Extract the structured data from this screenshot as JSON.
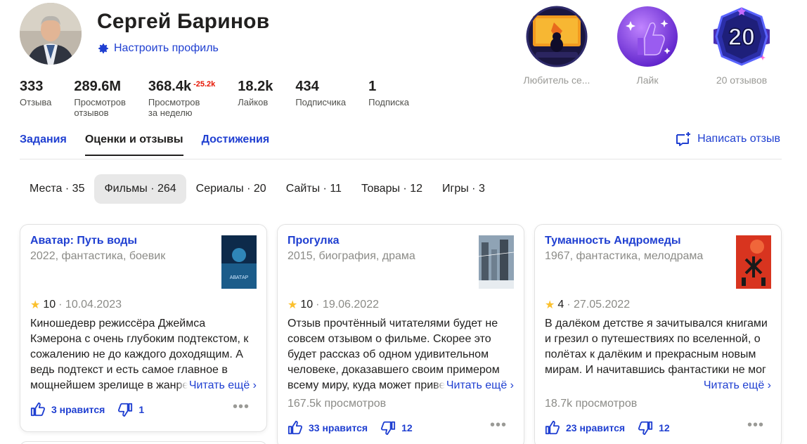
{
  "profile": {
    "name": "Сергей Баринов",
    "configure_label": "Настроить профиль"
  },
  "stats": [
    {
      "value": "333",
      "delta": "",
      "label1": "Отзыва",
      "label2": ""
    },
    {
      "value": "289.6M",
      "delta": "",
      "label1": "Просмотров",
      "label2": "отзывов"
    },
    {
      "value": "368.4k",
      "delta": "-25.2k",
      "label1": "Просмотров",
      "label2": "за неделю"
    },
    {
      "value": "18.2k",
      "delta": "",
      "label1": "Лайков",
      "label2": ""
    },
    {
      "value": "434",
      "delta": "",
      "label1": "Подписчика",
      "label2": ""
    },
    {
      "value": "1",
      "delta": "",
      "label1": "Подписка",
      "label2": ""
    }
  ],
  "badges": [
    {
      "icon": "movie-lover-badge-icon",
      "caption": "Любитель се..."
    },
    {
      "icon": "like-badge-icon",
      "caption": "Лайк"
    },
    {
      "icon": "reviews-20-badge-icon",
      "caption": "20 отзывов",
      "number": "20"
    }
  ],
  "tabs": [
    {
      "label": "Задания",
      "active": false
    },
    {
      "label": "Оценки и отзывы",
      "active": true
    },
    {
      "label": "Достижения",
      "active": false
    }
  ],
  "write_review_label": "Написать отзыв",
  "filters": [
    {
      "label": "Места · 35",
      "active": false
    },
    {
      "label": "Фильмы · 264",
      "active": true
    },
    {
      "label": "Сериалы · 20",
      "active": false
    },
    {
      "label": "Сайты · 11",
      "active": false
    },
    {
      "label": "Товары · 12",
      "active": false
    },
    {
      "label": "Игры · 3",
      "active": false
    }
  ],
  "read_more_label": "Читать ещё ›",
  "cards": [
    {
      "title": "Аватар: Путь воды",
      "meta": "2022, фантастика, боевик",
      "rating": "10",
      "date": "· 10.04.2023",
      "text": "Киношедевр режиссёра Джеймса Кэмерона с очень глубоким подтекстом, к сожалению не до каждого доходящим. А ведь подтекст и есть самое главное в мощнейшем зрелище в жанре",
      "views": "",
      "likes": "3 нравится",
      "dislikes": "1",
      "poster_text": "АВАТАР"
    },
    {
      "title": "Прогулка",
      "meta": "2015, биография, драма",
      "rating": "10",
      "date": "· 19.06.2022",
      "text": "Отзыв прочтённый читателями будет не совсем отзывом о фильме. Скорее это будет рассказ об одном удивительном человеке, доказавшего своим примером всему миру, куда может привести",
      "views": "167.5k просмотров",
      "likes": "33 нравится",
      "dislikes": "12",
      "poster_text": ""
    },
    {
      "title": "Туманность Андромеды",
      "meta": "1967, фантастика, мелодрама",
      "rating": "4",
      "date": "· 27.05.2022",
      "text": "В далёком детстве я зачитывался книгами и грезил о путешествиях по вселенной, о полётах к далёким и прекрасным новым мирам. И начитавшись фантастики не мог",
      "views": "18.7k просмотров",
      "likes": "23 нравится",
      "dislikes": "12",
      "poster_text": ""
    }
  ],
  "colors": {
    "link": "#1f3fd1",
    "star": "#fbc02d",
    "delta": "#e61400"
  }
}
